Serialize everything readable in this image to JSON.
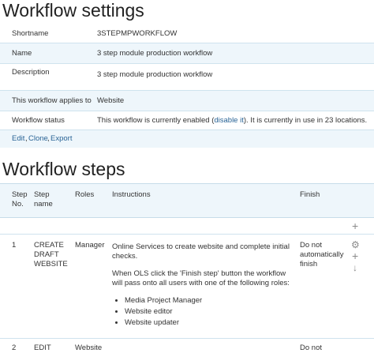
{
  "settings_title": "Workflow settings",
  "settings": {
    "shortname_label": "Shortname",
    "shortname_value": "3STEPMPWORKFLOW",
    "name_label": "Name",
    "name_value": "3 step module production workflow",
    "description_label": "Description",
    "description_value": "3 step module production workflow",
    "applies_label": "This workflow applies to",
    "applies_value": "Website",
    "status_label": "Workflow status",
    "status_prefix": "This workflow is currently enabled (",
    "status_link": "disable it",
    "status_suffix": "). It is currently in use in 23 locations."
  },
  "actions": {
    "edit": "Edit",
    "clone": "Clone",
    "export": "Export",
    "sep": ","
  },
  "steps_title": "Workflow steps",
  "steps_table": {
    "headers": {
      "step_no_1": "Step",
      "step_no_2": "No.",
      "step_name_1": "Step",
      "step_name_2": "name",
      "roles": "Roles",
      "instructions": "Instructions",
      "finish": "Finish"
    },
    "rows": [
      {
        "number": "1",
        "name_lines": [
          "CREATE",
          "DRAFT",
          "WEBSITE"
        ],
        "roles": "Manager",
        "instructions_p1": "Online Services to create website and complete initial checks.",
        "instructions_p2": "When OLS click the 'Finish step' button the workflow will pass onto all users with one of the following roles:",
        "role_list": [
          "Media Project Manager",
          "Website editor",
          "Website updater"
        ],
        "finish_lines": [
          "Do not",
          "automatically",
          "finish"
        ]
      },
      {
        "number": "2",
        "name_lines": [
          "EDIT"
        ],
        "roles": "Website",
        "finish_lines": [
          "Do not"
        ]
      }
    ]
  },
  "icons": {
    "add": "plus-icon",
    "settings": "gear-icon",
    "move_up": "arrow-up-icon",
    "move_down": "arrow-down-icon"
  }
}
